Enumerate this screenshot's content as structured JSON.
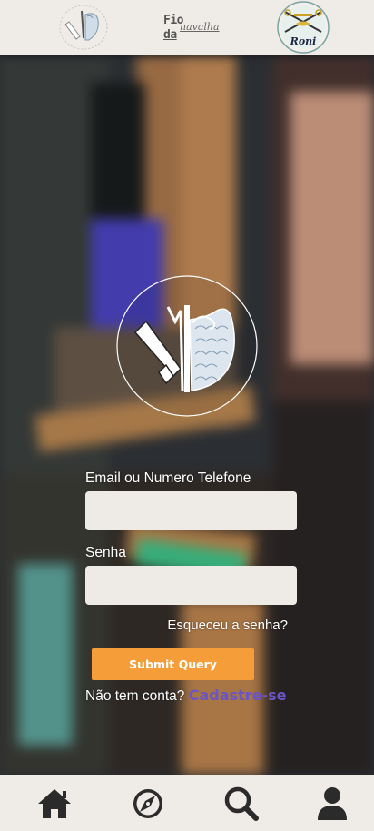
{
  "header": {
    "brand_line1": "Fio",
    "brand_line2": "da",
    "brand_line3": "navalha",
    "badge_name": "Roni"
  },
  "form": {
    "email_label": "Email ou Numero Telefone",
    "email_value": "",
    "password_label": "Senha",
    "password_value": "",
    "forgot_link": "Esqueceu a senha?",
    "submit_label": "Submit Query",
    "no_account_text": "Não tem conta?",
    "signup_link": "Cadastre-se"
  },
  "bottom_nav": {
    "items": [
      {
        "name": "home-icon"
      },
      {
        "name": "compass-icon"
      },
      {
        "name": "search-icon"
      },
      {
        "name": "user-icon"
      }
    ]
  },
  "colors": {
    "bar_background": "#efebe6",
    "submit_button": "#f59d38",
    "signup_link": "#6a55c8",
    "input_background": "#eeebe6",
    "icon_color": "#2b2b2b"
  }
}
